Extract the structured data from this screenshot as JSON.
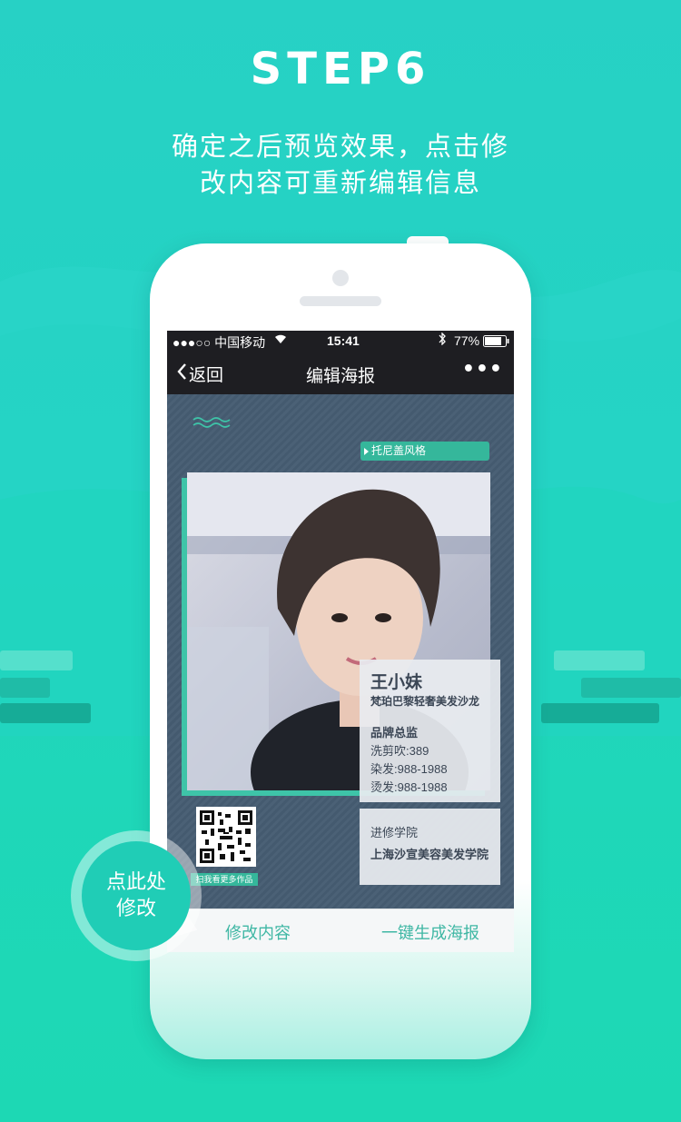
{
  "header": {
    "step": "STEP6",
    "desc_line1": "确定之后预览效果，点击修",
    "desc_line2": "改内容可重新编辑信息"
  },
  "statusbar": {
    "carrier": "●●●○○ 中国移动",
    "time": "15:41",
    "battery": "77%",
    "battery_level": 0.77
  },
  "navbar": {
    "back_label": "返回",
    "title": "编辑海报",
    "more": "•••"
  },
  "poster": {
    "style_tag": "托尼盖风格",
    "name": "王小妹",
    "salon": "梵珀巴黎轻奢美发沙龙",
    "role": "品牌总监",
    "prices": [
      "洗剪吹:389",
      "染发:988-1988",
      "烫发:988-1988"
    ],
    "school_label": "进修学院",
    "school_name": "上海沙宣美容美发学院",
    "qr_caption": "扫我看更多作品"
  },
  "bottombar": {
    "edit_label": "修改内容",
    "generate_label": "一键生成海报"
  },
  "callout": {
    "line1": "点此处",
    "line2": "修改"
  },
  "colors": {
    "accent": "#35b79b",
    "bg_teal": "#22d4c2",
    "nav_dark": "#1e1e22",
    "poster_slate": "#445a6f"
  }
}
